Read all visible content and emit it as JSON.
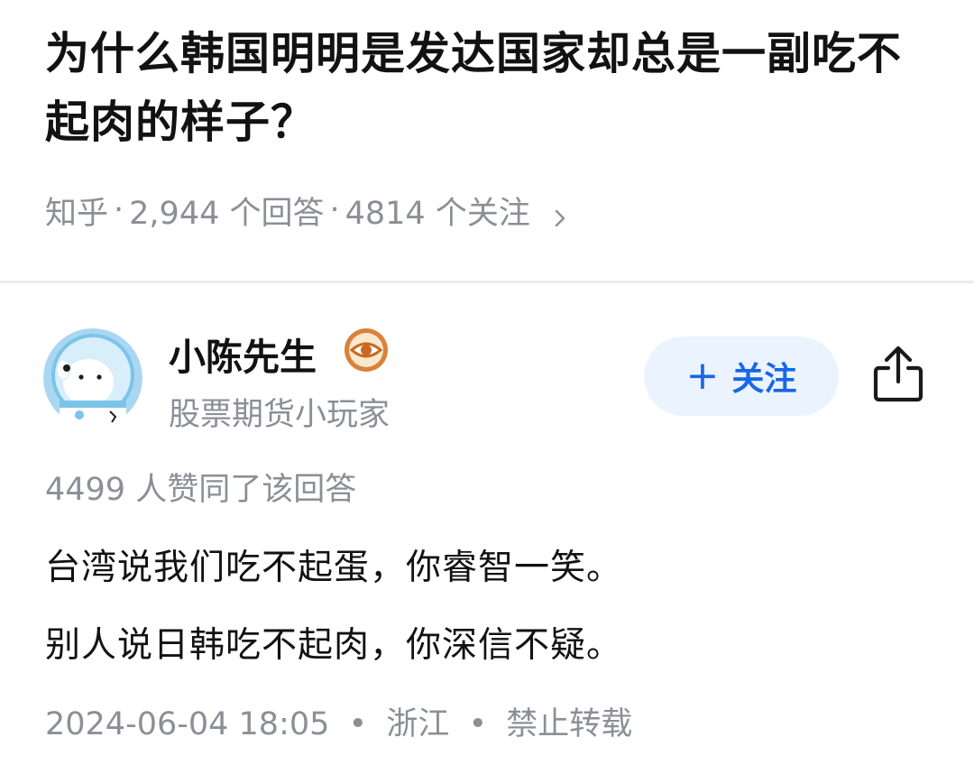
{
  "question": {
    "title": "为什么韩国明明是发达国家却总是一副吃不起肉的样子？",
    "meta": {
      "source": "知乎",
      "answers": "2,944 个回答",
      "followers": "4814 个关注",
      "chevron_icon": "chevron-right-icon"
    }
  },
  "answer": {
    "author": {
      "name": "小陈先生",
      "bio": "股票期货小玩家",
      "avatar_icon": "astronaut-dog-avatar",
      "badge_icon": "eye-badge-icon"
    },
    "follow": {
      "label": "关注",
      "plus": "+"
    },
    "share_icon": "share-icon",
    "vote_text": "4499 人赞同了该回答",
    "paragraphs": [
      "台湾说我们吃不起蛋，你睿智一笑。",
      "别人说日韩吃不起肉，你深信不疑。"
    ],
    "meta": {
      "time": "2024-06-04 18:05",
      "location": "浙江",
      "copyright": "禁止转载"
    }
  },
  "colors": {
    "text": "#121212",
    "muted": "#8b8f96",
    "accent": "#1766e8",
    "accent_bg": "#ebf3fe",
    "divider": "#ececee"
  }
}
